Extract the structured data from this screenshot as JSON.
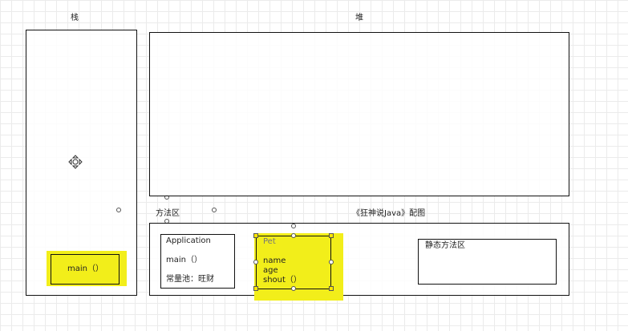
{
  "regions": {
    "stack_title": "栈",
    "heap_title": "堆",
    "method_area_title": "方法区",
    "figure_caption": "《狂神说Java》配图"
  },
  "stack": {
    "main_frame": "main（）"
  },
  "method_area": {
    "application": {
      "title": "Application",
      "method": "main（）",
      "constant_pool": "常量池：旺财"
    },
    "pet": {
      "title": "Pet",
      "fields": [
        "name",
        "age",
        "shout（）"
      ]
    },
    "static_area": "静态方法区"
  },
  "colors": {
    "highlight": "#f2ee1a",
    "border": "#111111"
  },
  "icons": [
    "move-cursor-icon"
  ]
}
